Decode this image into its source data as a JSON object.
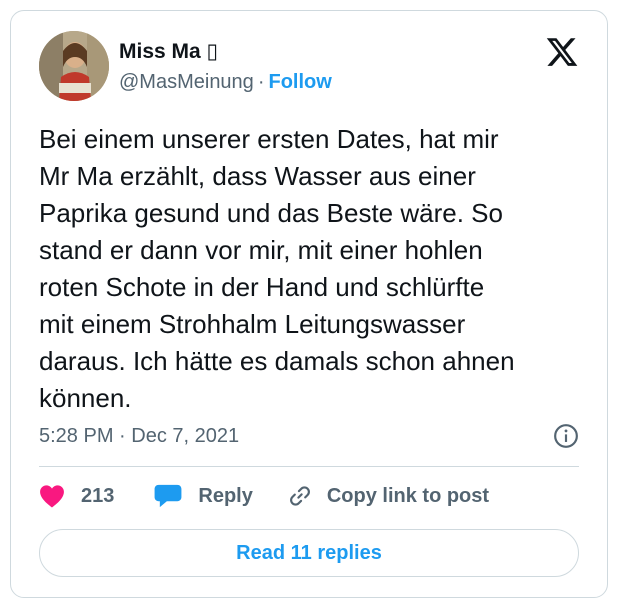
{
  "author": {
    "name": "Miss Ma",
    "name_emoji": "▯",
    "handle": "@MasMeinung",
    "separator": "·",
    "follow_label": "Follow"
  },
  "tweet": {
    "text": "Bei einem unserer ersten Dates, hat mir\nMr Ma erzählt, dass Wasser aus einer\nPaprika gesund und das Beste wäre. So\nstand er dann vor mir, mit einer hohlen\nroten Schote in der Hand und schlürfte\nmit einem Strohhalm Leitungswasser\ndaraus. Ich hätte es damals schon ahnen\nkönnen.",
    "time": "5:28 PM",
    "date": "Dec 7, 2021",
    "separator": "·"
  },
  "actions": {
    "like_count": "213",
    "reply_label": "Reply",
    "copy_link_label": "Copy link to post"
  },
  "read_replies_label": "Read 11 replies",
  "icons": {
    "logo": "x-logo-icon",
    "info": "info-icon",
    "like": "heart-icon",
    "reply": "speech-bubble-icon",
    "copy": "link-icon"
  },
  "colors": {
    "accent": "#1d9bf0",
    "like": "#f91880",
    "text": "#0f1419",
    "muted": "#536471",
    "border": "#cfd9de"
  }
}
